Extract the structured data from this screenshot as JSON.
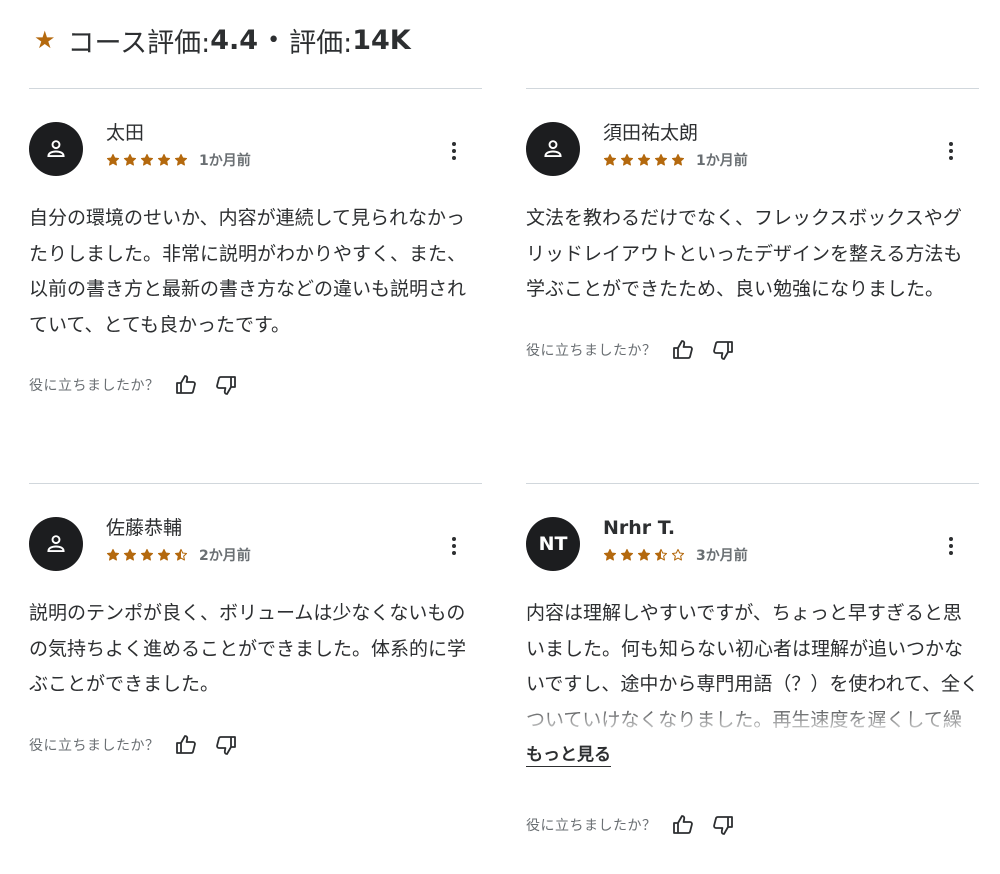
{
  "header": {
    "prefix": "コース評価: ",
    "rating": "4.4",
    "dot": "•",
    "count_prefix": "評価: ",
    "count": "14K"
  },
  "accent_color": "#b4690e",
  "reviews": [
    {
      "name": "太田",
      "avatar_icon": "user-icon",
      "stars": 5,
      "time": "1か月前",
      "content": "自分の環境のせいか、内容が連続して見られなかったりしました。非常に説明がわかりやすく、また、以前の書き方と最新の書き方などの違いも説明されていて、とても良かったです。",
      "helpful": "役に立ちましたか？"
    },
    {
      "name": "須田祐太朗",
      "avatar_icon": "user-icon",
      "stars": 5,
      "time": "1か月前",
      "content": "文法を教わるだけでなく、フレックスボックスやグリッドレイアウトといったデザインを整える方法も学ぶことができたため、良い勉強になりました。",
      "helpful": "役に立ちましたか？"
    },
    {
      "name": "佐藤恭輔",
      "avatar_icon": "user-icon",
      "stars": 4.5,
      "time": "2か月前",
      "content": "説明のテンポが良く、ボリュームは少なくないものの気持ちよく進めることができました。体系的に学ぶことができました。",
      "helpful": "役に立ちましたか？"
    },
    {
      "name": "Nrhr T.",
      "avatar_initials": "NT",
      "stars": 3.5,
      "time": "3か月前",
      "content": "内容は理解しやすいですが、ちょっと早すぎると思いました。何も知らない初心者は理解が追いつかないですし、途中から専門用語（？）を使われて、全くついていけなくなりました。再生速度を遅くして繰り返し学習しました。",
      "more": "もっと見る",
      "helpful": "役に立ちましたか？"
    }
  ]
}
